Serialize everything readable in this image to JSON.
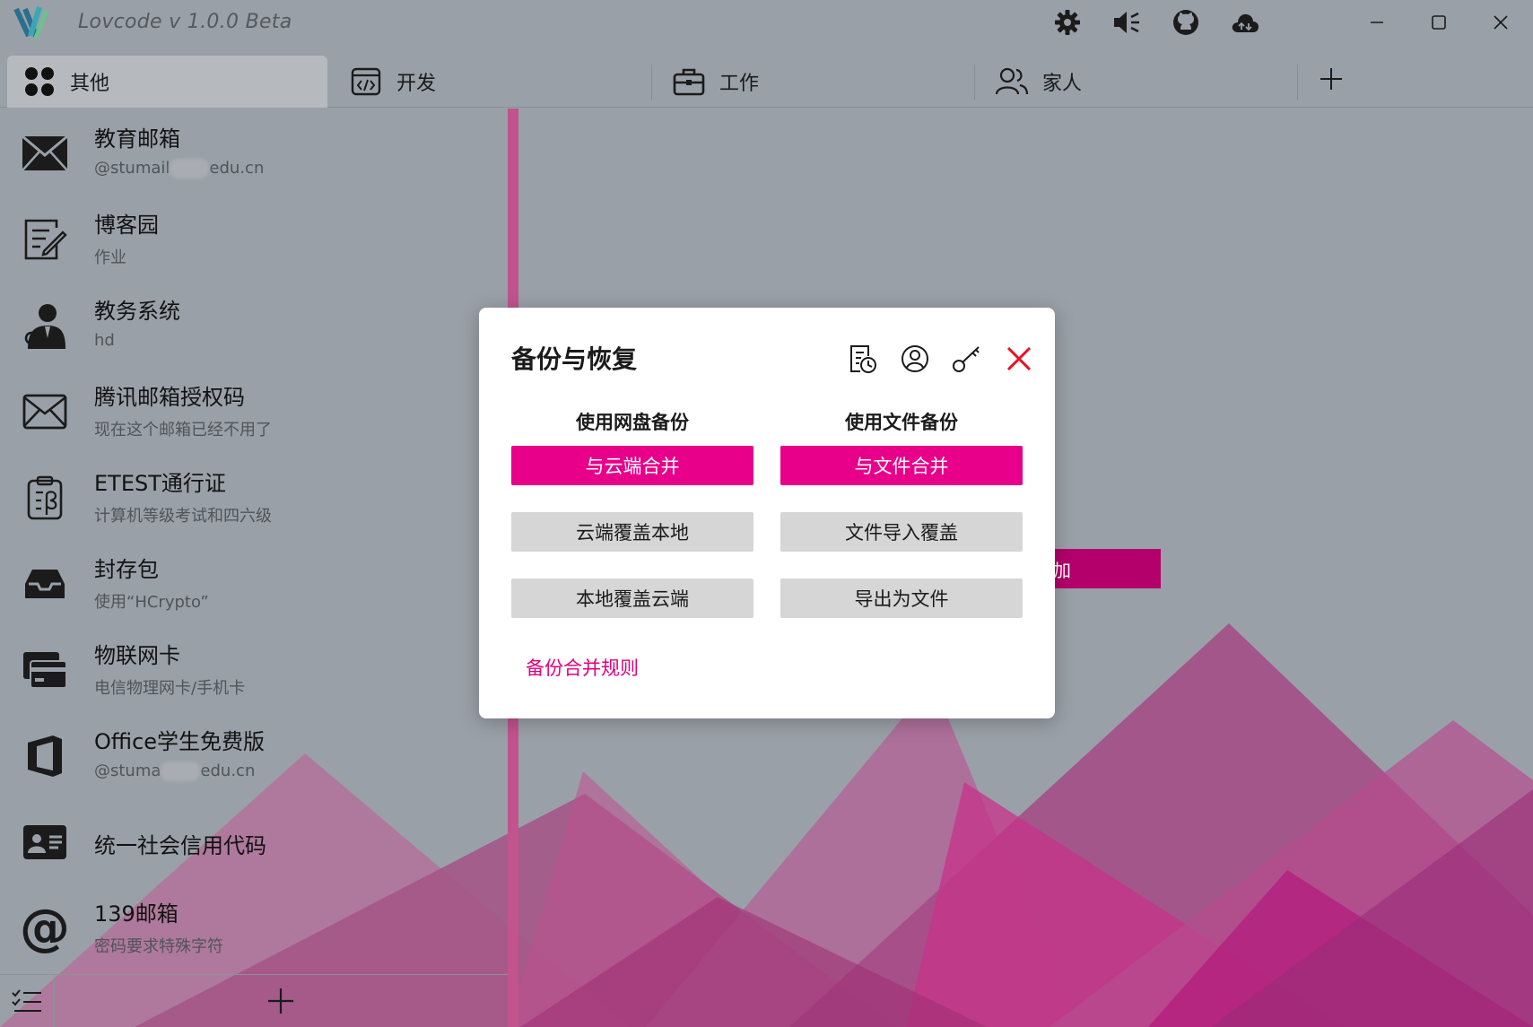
{
  "app": {
    "title": "Lovcode  v 1.0.0 Beta"
  },
  "titlebar": {
    "icons": [
      "gear-icon",
      "speaker-icon",
      "github-icon",
      "cloud-sync-icon"
    ],
    "window_controls": [
      "minimize-icon",
      "maximize-icon",
      "close-icon"
    ]
  },
  "tabs": [
    {
      "label": "其他",
      "icon": "apps-grid-icon",
      "active": true
    },
    {
      "label": "开发",
      "icon": "code-window-icon",
      "active": false
    },
    {
      "label": "工作",
      "icon": "briefcase-icon",
      "active": false
    },
    {
      "label": "家人",
      "icon": "people-icon",
      "active": false
    }
  ],
  "sidebar": {
    "items": [
      {
        "name": "教育邮箱",
        "sub_pre": "@stumail",
        "sub_post": "edu.cn",
        "icon": "envelope-icon"
      },
      {
        "name": "博客园",
        "sub": "作业",
        "icon": "note-edit-icon"
      },
      {
        "name": "教务系统",
        "sub": "hd",
        "icon": "teacher-icon"
      },
      {
        "name": "腾讯邮箱授权码",
        "sub": "现在这个邮箱已经不用了",
        "icon": "envelope-outline-icon"
      },
      {
        "name": "ETEST通行证",
        "sub": "计算机等级考试和四六级",
        "icon": "clipboard-beta-icon"
      },
      {
        "name": "封存包",
        "sub": "使用“HCrypto”",
        "icon": "inbox-tray-icon"
      },
      {
        "name": "物联网卡",
        "sub": "电信物理网卡/手机卡",
        "icon": "card-icon"
      },
      {
        "name": "Office学生免费版",
        "sub_pre": "@stuma",
        "sub_post": "edu.cn",
        "icon": "office-icon"
      },
      {
        "name": "统一社会信用代码",
        "icon": "id-card-icon"
      },
      {
        "name": "139邮箱",
        "sub": "密码要求特殊字符",
        "icon": "at-sign-icon"
      }
    ]
  },
  "bottombar": {
    "icons": [
      "checklist-icon",
      "plus-icon"
    ]
  },
  "background_button": {
    "label": "加"
  },
  "dialog": {
    "title": "备份与恢复",
    "icons": [
      "log-history-icon",
      "account-icon",
      "key-icon",
      "close-icon"
    ],
    "cloud": {
      "heading": "使用网盘备份",
      "merge": "与云端合并",
      "overwrite_local": "云端覆盖本地",
      "overwrite_cloud": "本地覆盖云端"
    },
    "file": {
      "heading": "使用文件备份",
      "merge": "与文件合并",
      "import_overwrite": "文件导入覆盖",
      "export": "导出为文件"
    },
    "rules_link": "备份合并规则"
  },
  "colors": {
    "accent": "#e8008a",
    "secondary_button": "#d6d6d6",
    "close_red": "#e81123"
  }
}
